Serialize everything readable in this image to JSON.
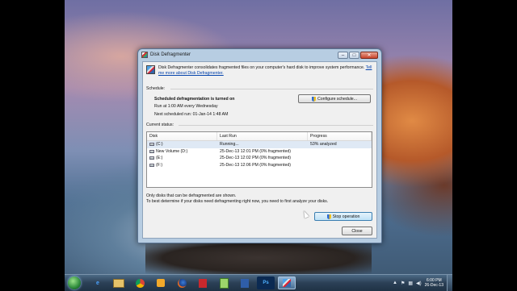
{
  "window": {
    "title": "Disk Defragmenter",
    "controls": {
      "minimize": "–",
      "maximize": "□",
      "close": "✕"
    }
  },
  "intro": {
    "text": "Disk Defragmenter consolidates fragmented files on your computer's hard disk to improve system performance.",
    "link": "Tell me more about Disk Defragmenter."
  },
  "schedule": {
    "label": "Schedule:",
    "status": "Scheduled defragmentation is turned on",
    "run_at": "Run at 1:00 AM every Wednesday",
    "next_run": "Next scheduled run: 01-Jan-14 1:48 AM",
    "configure_button": "Configure schedule..."
  },
  "current_status": {
    "label": "Current status:",
    "columns": [
      "Disk",
      "Last Run",
      "Progress"
    ],
    "rows": [
      {
        "disk": "(C:)",
        "last_run": "Running...",
        "progress": "53% analyzed"
      },
      {
        "disk": "New Volume (D:)",
        "last_run": "25-Dec-13 12:01 PM (0% fragmented)",
        "progress": ""
      },
      {
        "disk": "(E:)",
        "last_run": "25-Dec-13 12:02 PM (0% fragmented)",
        "progress": ""
      },
      {
        "disk": "(F:)",
        "last_run": "25-Dec-13 12:06 PM (0% fragmented)",
        "progress": ""
      }
    ]
  },
  "notes": {
    "line1": "Only disks that can be defragmented are shown.",
    "line2": "To best determine if your disks need defragmenting right now, you need to first analyze your disks."
  },
  "buttons": {
    "stop": "Stop operation",
    "close": "Close"
  },
  "taskbar": {
    "apps": [
      "ie-icon",
      "explorer-icon",
      "chrome-icon",
      "media-icon",
      "firefox-icon",
      "acrobat-icon",
      "notepad-icon",
      "word-icon",
      "photoshop-icon",
      "defrag-icon"
    ],
    "photoshop_label": "Ps",
    "time": "6:00 PM",
    "date": "26-Dec-13"
  }
}
